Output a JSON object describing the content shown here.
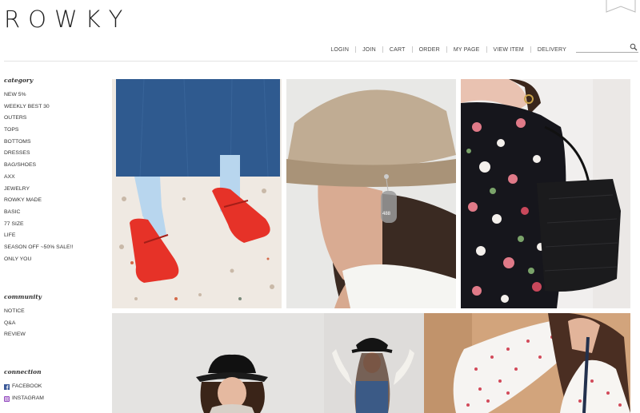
{
  "brand": {
    "logo": "ROWKY"
  },
  "top_nav": {
    "items": [
      "LOGIN",
      "JOIN",
      "CART",
      "ORDER",
      "MY PAGE",
      "VIEW ITEM",
      "DELIVERY"
    ]
  },
  "search": {
    "placeholder": "",
    "value": ""
  },
  "sidebar": {
    "category": {
      "title": "category",
      "items": [
        "NEW 5%",
        "WEEKLY BEST 30",
        "OUTERS",
        "TOPS",
        "BOTTOMS",
        "DRESSES",
        "BAG/SHOES",
        "AXX",
        "JEWELRY",
        "ROWKY MADE",
        "BASIC",
        "77 SIZE",
        "LIFE",
        "SEASON OFF ~50% SALE!!",
        "ONLY YOU"
      ]
    },
    "community": {
      "title": "community",
      "items": [
        "NOTICE",
        "Q&A",
        "REVIEW"
      ]
    },
    "connection": {
      "title": "connection",
      "items": [
        {
          "label": "FACEBOOK",
          "icon": "facebook-icon",
          "color": "#3b5998"
        },
        {
          "label": "INSTAGRAM",
          "icon": "instagram-icon",
          "color": "#8a3ab9"
        }
      ]
    }
  },
  "gallery": {
    "photos": [
      {
        "subject": "red-shoes-photo"
      },
      {
        "subject": "bucket-hat-earring-photo"
      },
      {
        "subject": "floral-blouse-bag-photo"
      },
      {
        "subject": "black-bucket-hat-banner-photo"
      }
    ]
  }
}
